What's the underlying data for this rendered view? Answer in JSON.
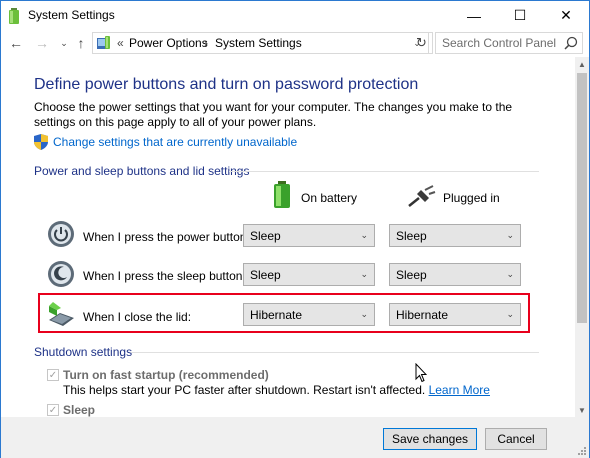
{
  "window": {
    "title": "System Settings",
    "minimize_glyph": "—",
    "maximize_glyph": "☐",
    "close_glyph": "✕"
  },
  "nav": {
    "back_glyph": "←",
    "forward_glyph": "→",
    "recent_glyph": "⌄",
    "up_glyph": "↑",
    "breadcrumb_prefix": "«",
    "breadcrumb": [
      "Power Options",
      "System Settings"
    ],
    "breadcrumb_sep": "›",
    "dropdown_glyph": "⌄",
    "refresh_glyph": "↻",
    "search_placeholder": "Search Control Panel"
  },
  "main": {
    "heading": "Define power buttons and turn on password protection",
    "description": "Choose the power settings that you want for your computer. The changes you make to the settings on this page apply to all of your power plans.",
    "change_link": "Change settings that are currently unavailable",
    "power_section_title": "Power and sleep buttons and lid settings",
    "col_battery": "On battery",
    "col_plugged": "Plugged in",
    "rows": [
      {
        "label": "When I press the power button:",
        "battery": "Sleep",
        "plugged": "Sleep",
        "icon": "power-button-icon"
      },
      {
        "label": "When I press the sleep button:",
        "battery": "Sleep",
        "plugged": "Sleep",
        "icon": "sleep-button-icon"
      },
      {
        "label": "When I close the lid:",
        "battery": "Hibernate",
        "plugged": "Hibernate",
        "icon": "laptop-lid-icon"
      }
    ],
    "chevron_glyph": "⌄",
    "shutdown_section_title": "Shutdown settings",
    "fast_startup_label": "Turn on fast startup (recommended)",
    "fast_startup_desc": "This helps start your PC faster after shutdown. Restart isn't affected.",
    "learn_more": "Learn More",
    "sleep_label": "Sleep",
    "check_glyph": "✓"
  },
  "scrollbar": {
    "up_glyph": "▲",
    "down_glyph": "▼"
  },
  "footer": {
    "save_label": "Save changes",
    "cancel_label": "Cancel"
  },
  "colors": {
    "heading": "#1e3287",
    "link": "#0066cc",
    "highlight_border": "#e8001c",
    "window_border": "#2b79d0"
  }
}
